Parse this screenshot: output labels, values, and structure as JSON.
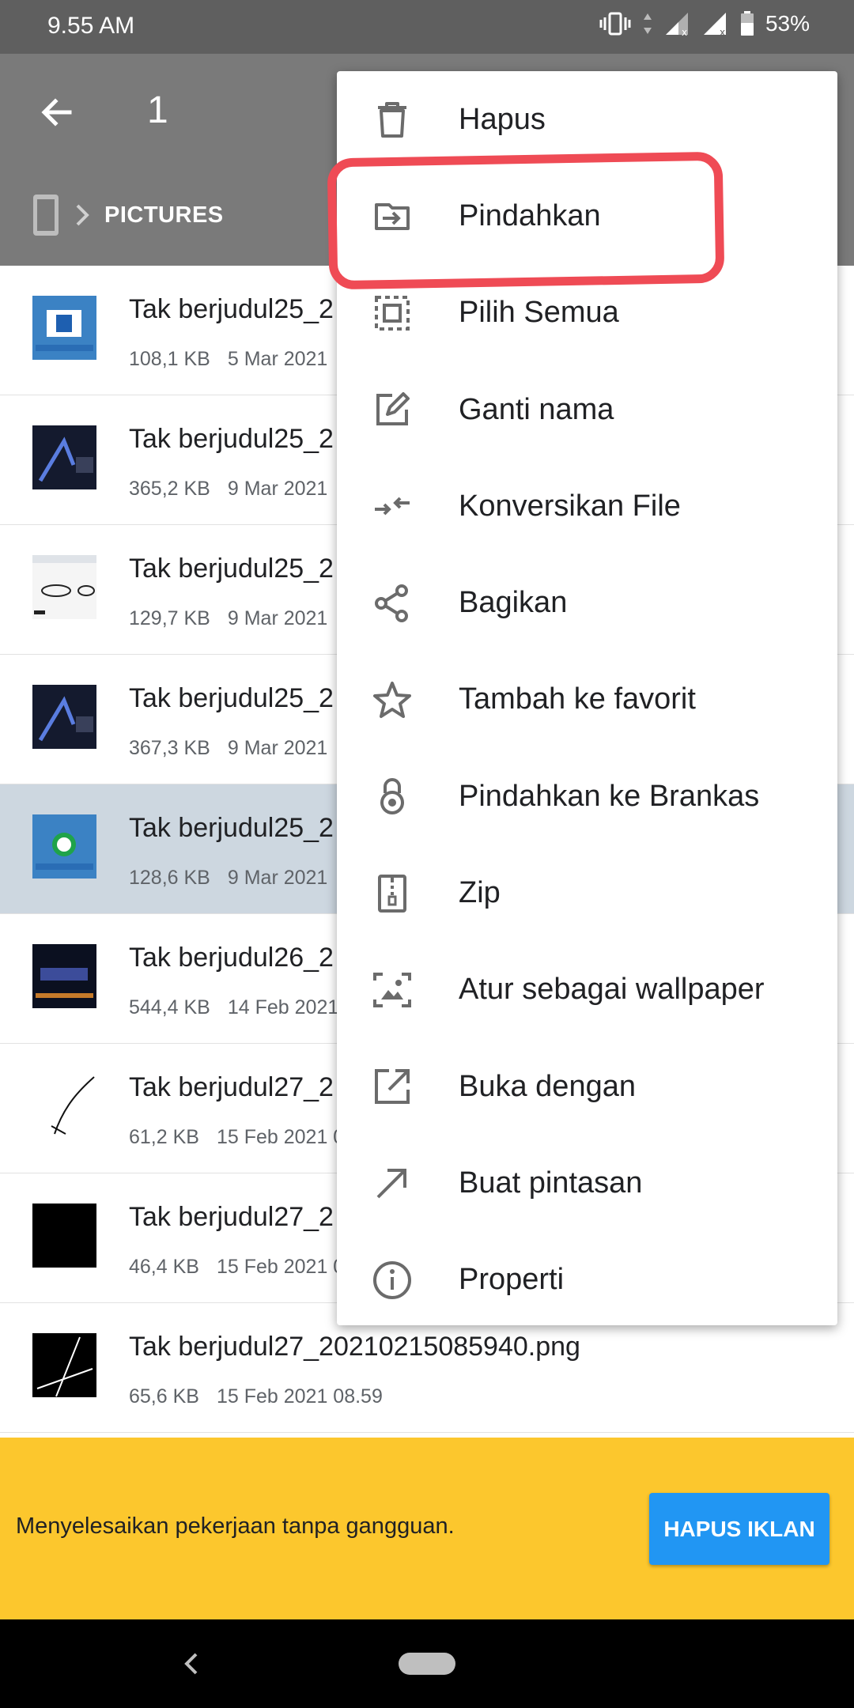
{
  "status_bar": {
    "time": "9.55 AM",
    "battery": "53%"
  },
  "app_bar": {
    "selected_count": "1",
    "breadcrumb": "PICTURES"
  },
  "files": [
    {
      "name": "Tak berjudul25_2",
      "size": "108,1 KB",
      "date": "5 Mar 2021",
      "selected": false
    },
    {
      "name": "Tak berjudul25_2",
      "size": "365,2 KB",
      "date": "9 Mar 2021",
      "selected": false
    },
    {
      "name": "Tak berjudul25_2",
      "size": "129,7 KB",
      "date": "9 Mar 2021",
      "selected": false
    },
    {
      "name": "Tak berjudul25_2",
      "size": "367,3 KB",
      "date": "9 Mar 2021",
      "selected": false
    },
    {
      "name": "Tak berjudul25_2",
      "size": "128,6 KB",
      "date": "9 Mar 2021",
      "selected": true
    },
    {
      "name": "Tak berjudul26_2",
      "size": "544,4 KB",
      "date": "14 Feb 2021",
      "selected": false
    },
    {
      "name": "Tak berjudul27_2",
      "size": "61,2 KB",
      "date": "15 Feb 2021 0",
      "selected": false
    },
    {
      "name": "Tak berjudul27_2",
      "size": "46,4 KB",
      "date": "15 Feb 2021 0",
      "selected": false
    },
    {
      "name": "Tak berjudul27_20210215085940.png",
      "size": "65,6 KB",
      "date": "15 Feb 2021 08.59",
      "selected": false
    }
  ],
  "menu": {
    "items": [
      {
        "label": "Hapus",
        "icon": "trash-icon"
      },
      {
        "label": "Pindahkan",
        "icon": "move-icon"
      },
      {
        "label": "Pilih Semua",
        "icon": "select-all-icon"
      },
      {
        "label": "Ganti nama",
        "icon": "rename-icon"
      },
      {
        "label": "Konversikan File",
        "icon": "convert-icon"
      },
      {
        "label": "Bagikan",
        "icon": "share-icon"
      },
      {
        "label": "Tambah ke favorit",
        "icon": "star-icon"
      },
      {
        "label": "Pindahkan ke Brankas",
        "icon": "lock-icon"
      },
      {
        "label": "Zip",
        "icon": "zip-icon"
      },
      {
        "label": "Atur sebagai wallpaper",
        "icon": "wallpaper-icon"
      },
      {
        "label": "Buka dengan",
        "icon": "open-with-icon"
      },
      {
        "label": "Buat pintasan",
        "icon": "shortcut-icon"
      },
      {
        "label": "Properti",
        "icon": "info-icon"
      }
    ],
    "highlighted_item": "Pindahkan",
    "highlight_color": "#ef4b55"
  },
  "ad": {
    "text": "Menyelesaikan pekerjaan tanpa gangguan.",
    "button": "HAPUS IKLAN",
    "background": "#fcc72d",
    "button_color": "#2196f3"
  }
}
